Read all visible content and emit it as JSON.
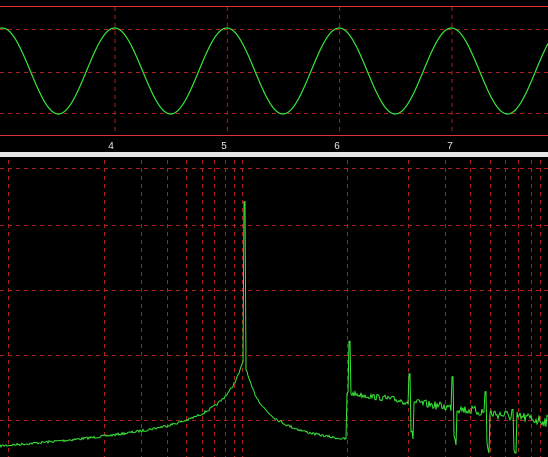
{
  "colors": {
    "background": "#000000",
    "trace": "#38e838",
    "grid": "#b02020",
    "frame": "#e03030",
    "divider": "#e6e6e6",
    "tick_text": "#e8e8e8"
  },
  "oscilloscope": {
    "x_tick_labels": [
      "4",
      "5",
      "6",
      "7"
    ],
    "chart_data": {
      "type": "line",
      "signal": "sine",
      "x_ticks": [
        4,
        5,
        6,
        7
      ],
      "x_range": [
        2.98,
        7.86
      ],
      "peaks_at_x": [
        4.0,
        5.0,
        6.0,
        7.0
      ],
      "cycles_per_x_unit": 1,
      "amplitude_divisions": 1
    }
  },
  "spectrum": {
    "chart_data": {
      "type": "line",
      "y_scale": "log",
      "features": [
        {
          "kind": "main-peak",
          "x_frac": 0.447,
          "level_frac": 0.86
        },
        {
          "kind": "harmonic",
          "x_frac": 0.637,
          "level_frac": 0.39
        },
        {
          "kind": "harmonic",
          "x_frac": 0.748,
          "level_frac": 0.28
        },
        {
          "kind": "harmonic",
          "x_frac": 0.826,
          "level_frac": 0.27
        },
        {
          "kind": "harmonic",
          "x_frac": 0.886,
          "level_frac": 0.22
        },
        {
          "kind": "harmonic",
          "x_frac": 0.936,
          "level_frac": 0.16
        }
      ]
    }
  }
}
